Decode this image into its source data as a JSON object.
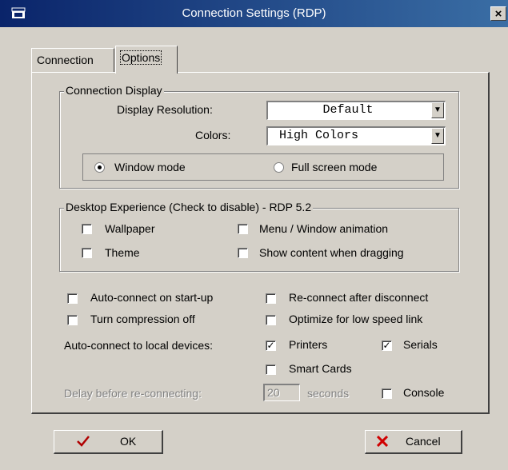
{
  "window": {
    "title": "Connection Settings (RDP)",
    "close_glyph": "×"
  },
  "tabs": [
    {
      "label": "Connection",
      "active": false
    },
    {
      "label": "Options",
      "active": true
    }
  ],
  "display_group": {
    "legend": "Connection Display",
    "resolution_label": "Display Resolution:",
    "resolution_value": "Default",
    "colors_label": "Colors:",
    "colors_value": "High Colors",
    "window_mode_label": "Window mode",
    "window_mode_selected": true,
    "full_screen_label": "Full screen mode",
    "full_screen_selected": false
  },
  "experience_group": {
    "legend": "Desktop Experience (Check to disable) - RDP 5.2",
    "wallpaper_label": "Wallpaper",
    "menu_animation_label": "Menu / Window animation",
    "theme_label": "Theme",
    "show_content_label": "Show content when dragging"
  },
  "options": {
    "auto_connect_label": "Auto-connect on start-up",
    "reconnect_label": "Re-connect after disconnect",
    "compression_label": "Turn compression off",
    "low_speed_label": "Optimize for low speed link",
    "local_devices_label": "Auto-connect to local devices:",
    "printers_label": "Printers",
    "printers_checked": true,
    "serials_label": "Serials",
    "serials_checked": true,
    "smart_cards_label": "Smart Cards",
    "delay_label": "Delay before re-connecting:",
    "delay_value": "20",
    "seconds_label": "seconds",
    "console_label": "Console",
    "check_glyph": "✓"
  },
  "buttons": {
    "ok_label": "OK",
    "ok_icon_color": "#b00000",
    "cancel_label": "Cancel",
    "cancel_icon_color": "#d00000"
  },
  "colors": {
    "titlebar_start": "#0a246a",
    "titlebar_end": "#3a6ea5",
    "dialog_bg": "#d4d0c8"
  },
  "icons": {
    "window": "window-menu-icon",
    "ok": "checkmark-icon",
    "cancel": "x-icon",
    "dropdown": "dropdown-arrow-icon"
  }
}
